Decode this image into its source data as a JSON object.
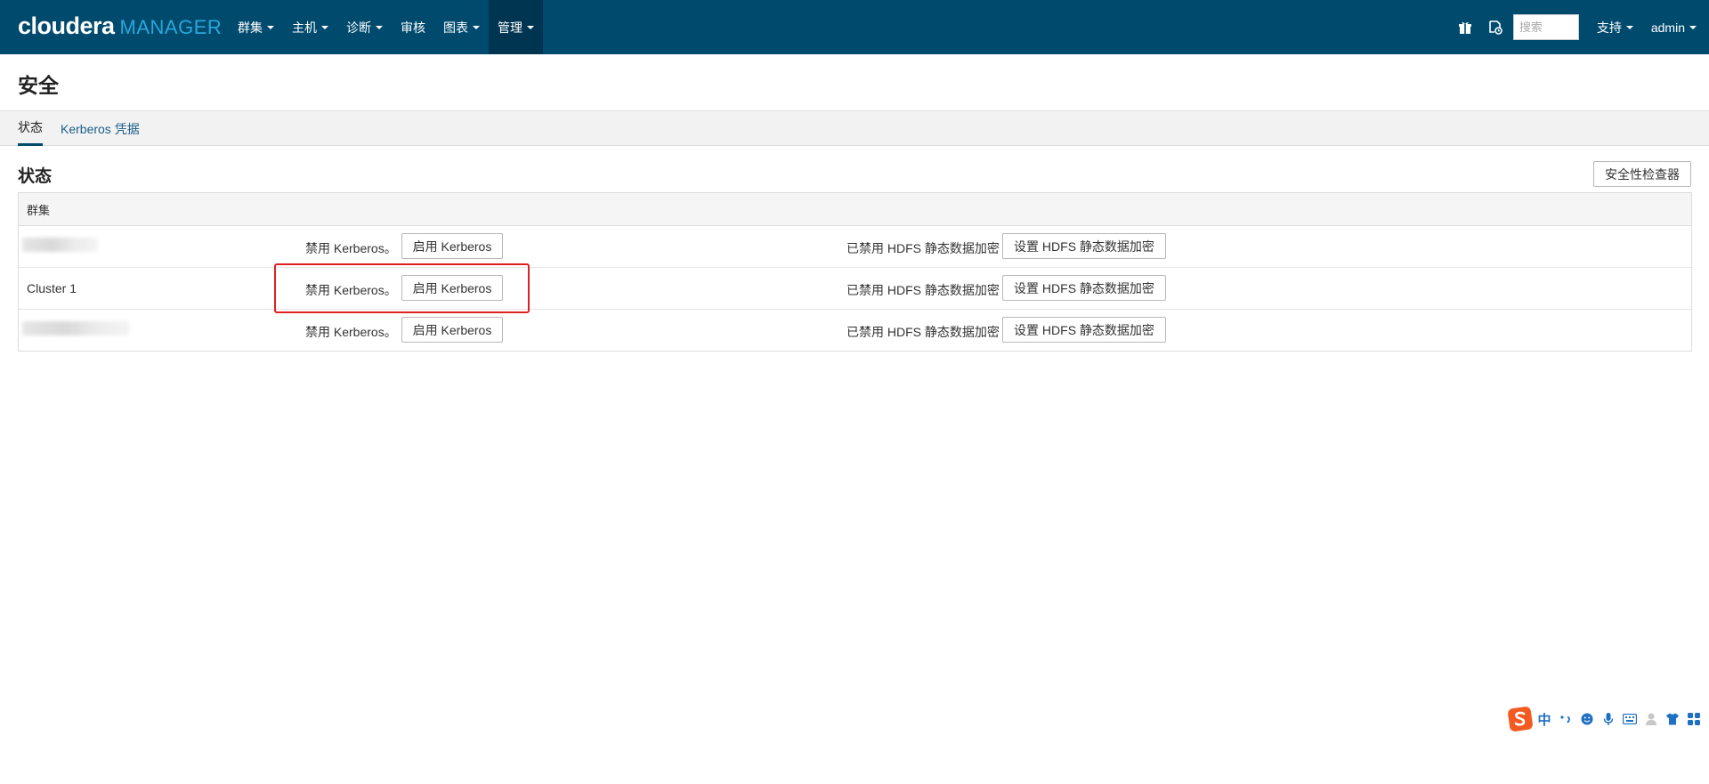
{
  "brand": {
    "main": "cloudera",
    "sub": "MANAGER"
  },
  "nav": {
    "items": [
      {
        "label": "群集",
        "caret": true
      },
      {
        "label": "主机",
        "caret": true
      },
      {
        "label": "诊断",
        "caret": true
      },
      {
        "label": "审核",
        "caret": false
      },
      {
        "label": "图表",
        "caret": true
      },
      {
        "label": "管理",
        "caret": true,
        "active": true
      }
    ],
    "search_placeholder": "搜索",
    "support_label": "支持",
    "user_label": "admin"
  },
  "page": {
    "title": "安全"
  },
  "tabs": [
    {
      "label": "状态",
      "active": true
    },
    {
      "label": "Kerberos 凭据",
      "active": false
    }
  ],
  "section": {
    "title": "状态",
    "security_inspector_label": "安全性检查器"
  },
  "table": {
    "header": "群集",
    "rows": [
      {
        "name": "",
        "name_redacted": true,
        "kerberos_status": "禁用 Kerberos。",
        "kerberos_button": "启用 Kerberos",
        "hdfs_status": "已禁用 HDFS 静态数据加密",
        "hdfs_button": "设置 HDFS 静态数据加密"
      },
      {
        "name": "Cluster 1",
        "name_redacted": false,
        "kerberos_status": "禁用 Kerberos。",
        "kerberos_button": "启用 Kerberos",
        "hdfs_status": "已禁用 HDFS 静态数据加密",
        "hdfs_button": "设置 HDFS 静态数据加密"
      },
      {
        "name": "",
        "name_redacted": true,
        "kerberos_status": "禁用 Kerberos。",
        "kerberos_button": "启用 Kerberos",
        "hdfs_status": "已禁用 HDFS 静态数据加密",
        "hdfs_button": "设置 HDFS 静态数据加密"
      }
    ]
  },
  "ime": {
    "mode_label": "中"
  },
  "colors": {
    "navbar": "#004a6e",
    "brand_accent": "#2aa7d9",
    "highlight": "#e02020",
    "link": "#1a5f8a"
  }
}
